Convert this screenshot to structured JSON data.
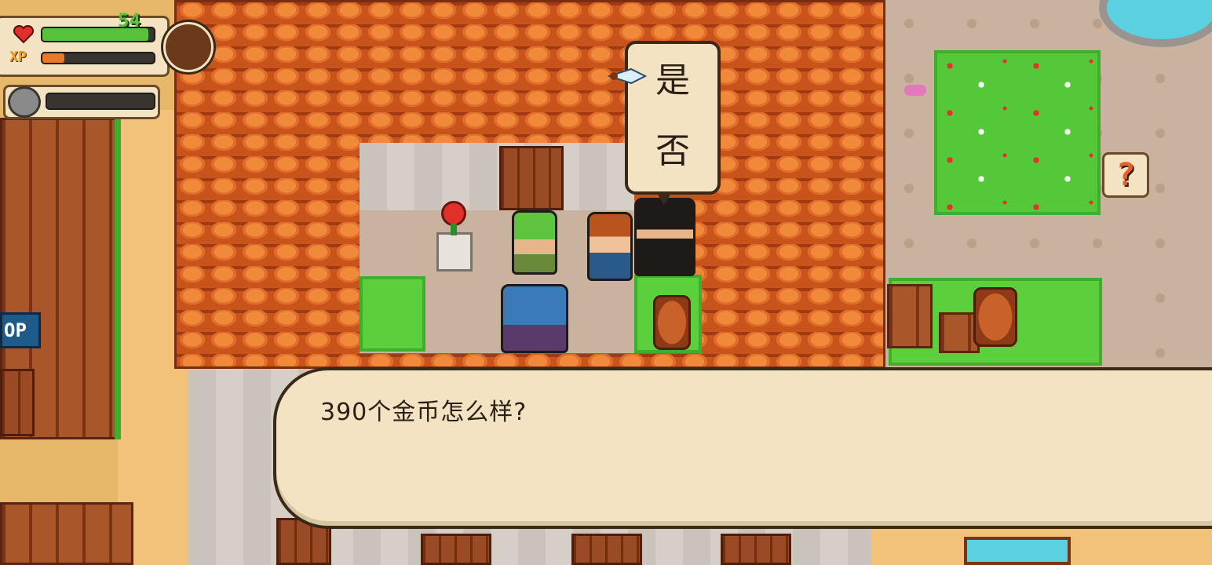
{
  "hud": {
    "health_value": "54",
    "health_fraction": 0.95,
    "xp_label": "XP",
    "xp_fraction": 0.2,
    "secondary_fraction": 0.0
  },
  "choice_menu": {
    "options": [
      "是",
      "否"
    ],
    "selected_index": 0
  },
  "dialogue": {
    "text": "390个金币怎么样?"
  },
  "shop_sign": {
    "text": "OP"
  },
  "hint_button": {
    "symbol": "?"
  },
  "icons": {
    "heart": "heart-icon",
    "xp": "xp-icon",
    "portrait": "player-portrait-icon",
    "pet": "pet-portrait-icon",
    "pointer": "selection-pointer-icon"
  },
  "colors": {
    "health": "#58c23a",
    "xp": "#e8782a",
    "roof": "#e06e2a",
    "grass": "#5ccf3c",
    "panel": "#f3e3c2"
  }
}
